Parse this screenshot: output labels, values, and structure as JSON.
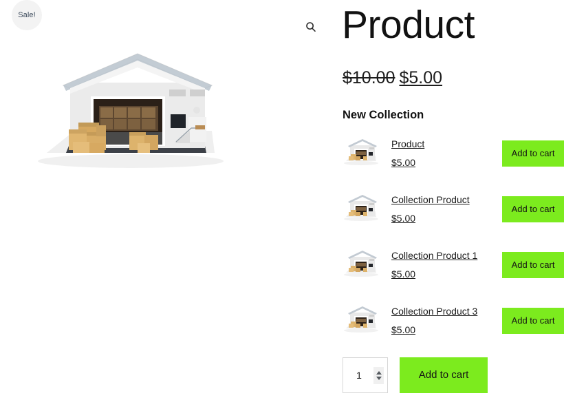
{
  "badge": {
    "sale_label": "Sale!"
  },
  "gallery": {
    "zoom_icon": "search-icon",
    "main_image_alt": "warehouse-with-boxes"
  },
  "summary": {
    "title": "Product",
    "price": {
      "old": "$10.00",
      "new": "$5.00"
    },
    "collection_heading": "New Collection",
    "items": [
      {
        "name": "Product",
        "price": "$5.00",
        "add_label": "Add to cart",
        "thumb_alt": "warehouse-with-boxes"
      },
      {
        "name": "Collection Product",
        "price": "$5.00",
        "add_label": "Add to cart",
        "thumb_alt": "warehouse-with-boxes"
      },
      {
        "name": "Collection Product 1",
        "price": "$5.00",
        "add_label": "Add to cart",
        "thumb_alt": "warehouse-with-boxes"
      },
      {
        "name": "Collection Product 3",
        "price": "$5.00",
        "add_label": "Add to cart",
        "thumb_alt": "warehouse-with-boxes"
      }
    ],
    "cart_form": {
      "quantity_value": "1",
      "quantity_placeholder": "1",
      "add_label": "Add to cart"
    }
  },
  "colors": {
    "accent_green": "#7ceb1e",
    "badge_bg": "#f3f3f3",
    "badge_text": "#3d4b5c",
    "text": "#1a1a1a"
  }
}
